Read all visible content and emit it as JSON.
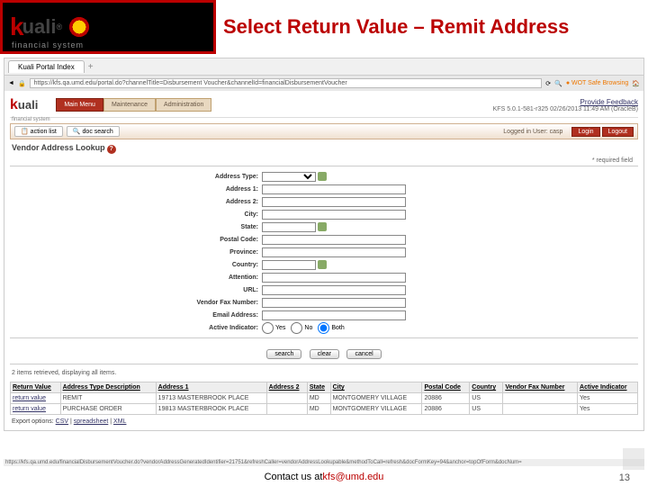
{
  "slide": {
    "title": "Select Return Value – Remit Address"
  },
  "logo": {
    "k": "k",
    "uali": "uali",
    "reg": "®",
    "fs": "financial system"
  },
  "browser": {
    "tab": "Kuali Portal Index",
    "url": "https://kfs.qa.umd.edu/portal.do?channelTitle=Disbursement Voucher&channelId=financialDisbursementVoucher"
  },
  "nav": {
    "main": "Main Menu",
    "maint": "Maintenance",
    "admin": "Administration"
  },
  "header": {
    "feedback": "Provide Feedback",
    "version": "KFS 5.0.1-581-r325 02/26/2013 11:49 AM (OracleB)"
  },
  "actions": {
    "list": "action list",
    "search": "doc search",
    "logged": "Logged in User: casp",
    "login": "Login",
    "logout": "Logout"
  },
  "lookup": {
    "title": "Vendor Address Lookup",
    "required": "* required field"
  },
  "fields": {
    "addressType": "Address Type:",
    "address1": "Address 1:",
    "address2": "Address 2:",
    "city": "City:",
    "state": "State:",
    "postal": "Postal Code:",
    "province": "Province:",
    "country": "Country:",
    "attention": "Attention:",
    "url": "URL:",
    "fax": "Vendor Fax Number:",
    "email": "Email Address:",
    "active": "Active Indicator:"
  },
  "radio": {
    "yes": "Yes",
    "no": "No",
    "both": "Both"
  },
  "buttons": {
    "search": "search",
    "clear": "clear",
    "cancel": "cancel"
  },
  "results": {
    "msg": "2 items retrieved, displaying all items.",
    "headers": {
      "ret": "Return Value",
      "type": "Address Type Description",
      "a1": "Address 1",
      "a2": "Address 2",
      "state": "State",
      "city": "City",
      "postal": "Postal Code",
      "country": "Country",
      "fax": "Vendor Fax Number",
      "active": "Active Indicator"
    },
    "rows": [
      {
        "ret": "return value",
        "type": "REMIT",
        "a1": "19713 MASTERBROOK PLACE",
        "a2": "",
        "state": "MD",
        "city": "MONTGOMERY VILLAGE",
        "postal": "20886",
        "country": "US",
        "fax": "",
        "active": "Yes"
      },
      {
        "ret": "return value",
        "type": "PURCHASE ORDER",
        "a1": "19813 MASTERBROOK PLACE",
        "a2": "",
        "state": "MD",
        "city": "MONTGOMERY VILLAGE",
        "postal": "20886",
        "country": "US",
        "fax": "",
        "active": "Yes"
      }
    ]
  },
  "export": {
    "label": "Export options:",
    "csv": "CSV",
    "ss": "spreadsheet",
    "xml": "XML"
  },
  "status": "https://kfs.qa.umd.edu/financialDisbursementVoucher.do?vendorAddressGeneratedIdentifier=21751&refreshCaller=vendorAddressLookupable&methodToCall=refresh&docFormKey=94&anchor=topOfForm&docNum=",
  "footer": {
    "contact": "Contact us at ",
    "email": "kfs@umd.edu",
    "page": "13"
  }
}
